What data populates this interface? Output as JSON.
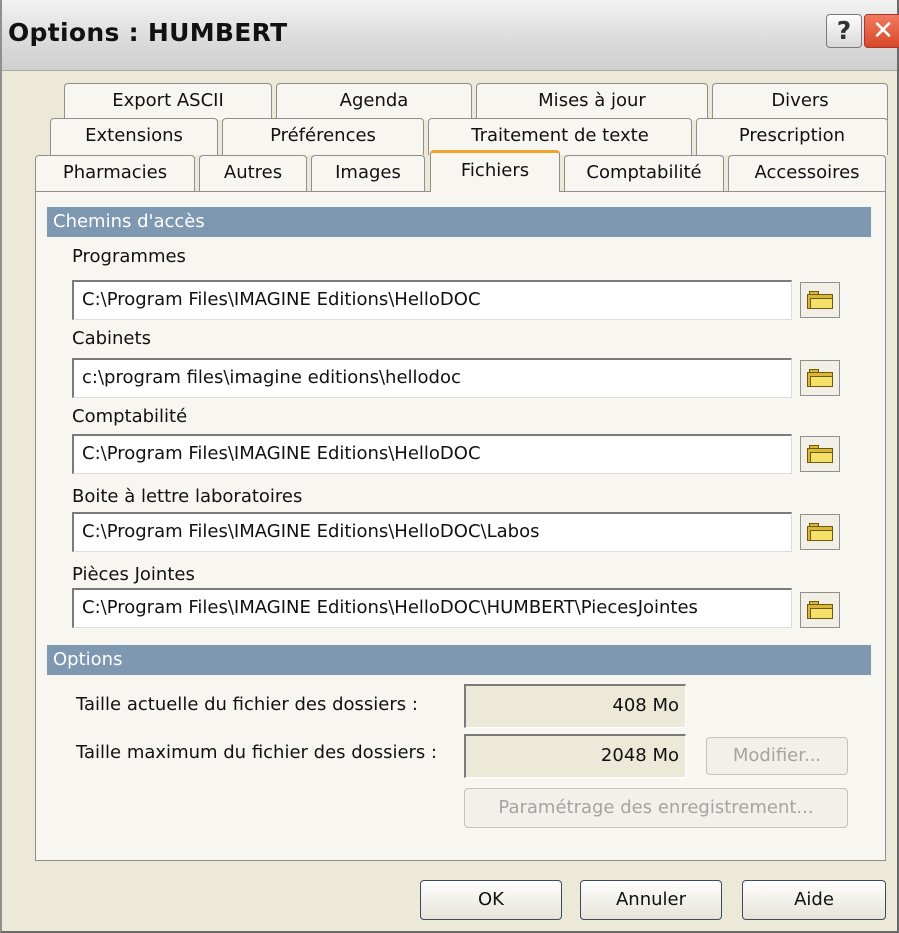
{
  "window": {
    "title": "Options : HUMBERT"
  },
  "tabs": {
    "row1": [
      "Export ASCII",
      "Agenda",
      "Mises à jour",
      "Divers"
    ],
    "row2": [
      "Extensions",
      "Préférences",
      "Traitement de texte",
      "Prescription"
    ],
    "row3": [
      "Pharmacies",
      "Autres",
      "Images",
      "Fichiers",
      "Comptabilité",
      "Accessoires"
    ],
    "active": "Fichiers"
  },
  "paths": {
    "section_title": "Chemins d'accès",
    "items": [
      {
        "label": "Programmes",
        "value": "C:\\Program Files\\IMAGINE Editions\\HelloDOC"
      },
      {
        "label": "Cabinets",
        "value": "c:\\program files\\imagine editions\\hellodoc"
      },
      {
        "label": "Comptabilité",
        "value": "C:\\Program Files\\IMAGINE Editions\\HelloDOC"
      },
      {
        "label": "Boite à lettre laboratoires",
        "value": "C:\\Program Files\\IMAGINE Editions\\HelloDOC\\Labos"
      },
      {
        "label": "Pièces Jointes",
        "value": "C:\\Program Files\\IMAGINE Editions\\HelloDOC\\HUMBERT\\PiecesJointes"
      }
    ]
  },
  "options": {
    "section_title": "Options",
    "current_size_label": "Taille actuelle  du fichier des dossiers :",
    "current_size_value": "408 Mo",
    "max_size_label": "Taille maximum du fichier des dossiers :",
    "max_size_value": "2048 Mo",
    "modify_button": "Modifier...",
    "settings_button": "Paramétrage des enregistrement..."
  },
  "footer": {
    "ok": "OK",
    "cancel": "Annuler",
    "help": "Aide"
  },
  "colors": {
    "section_header": "#7d98b0",
    "active_tab_accent": "#f0a22b",
    "close_button": "#d9482a"
  }
}
